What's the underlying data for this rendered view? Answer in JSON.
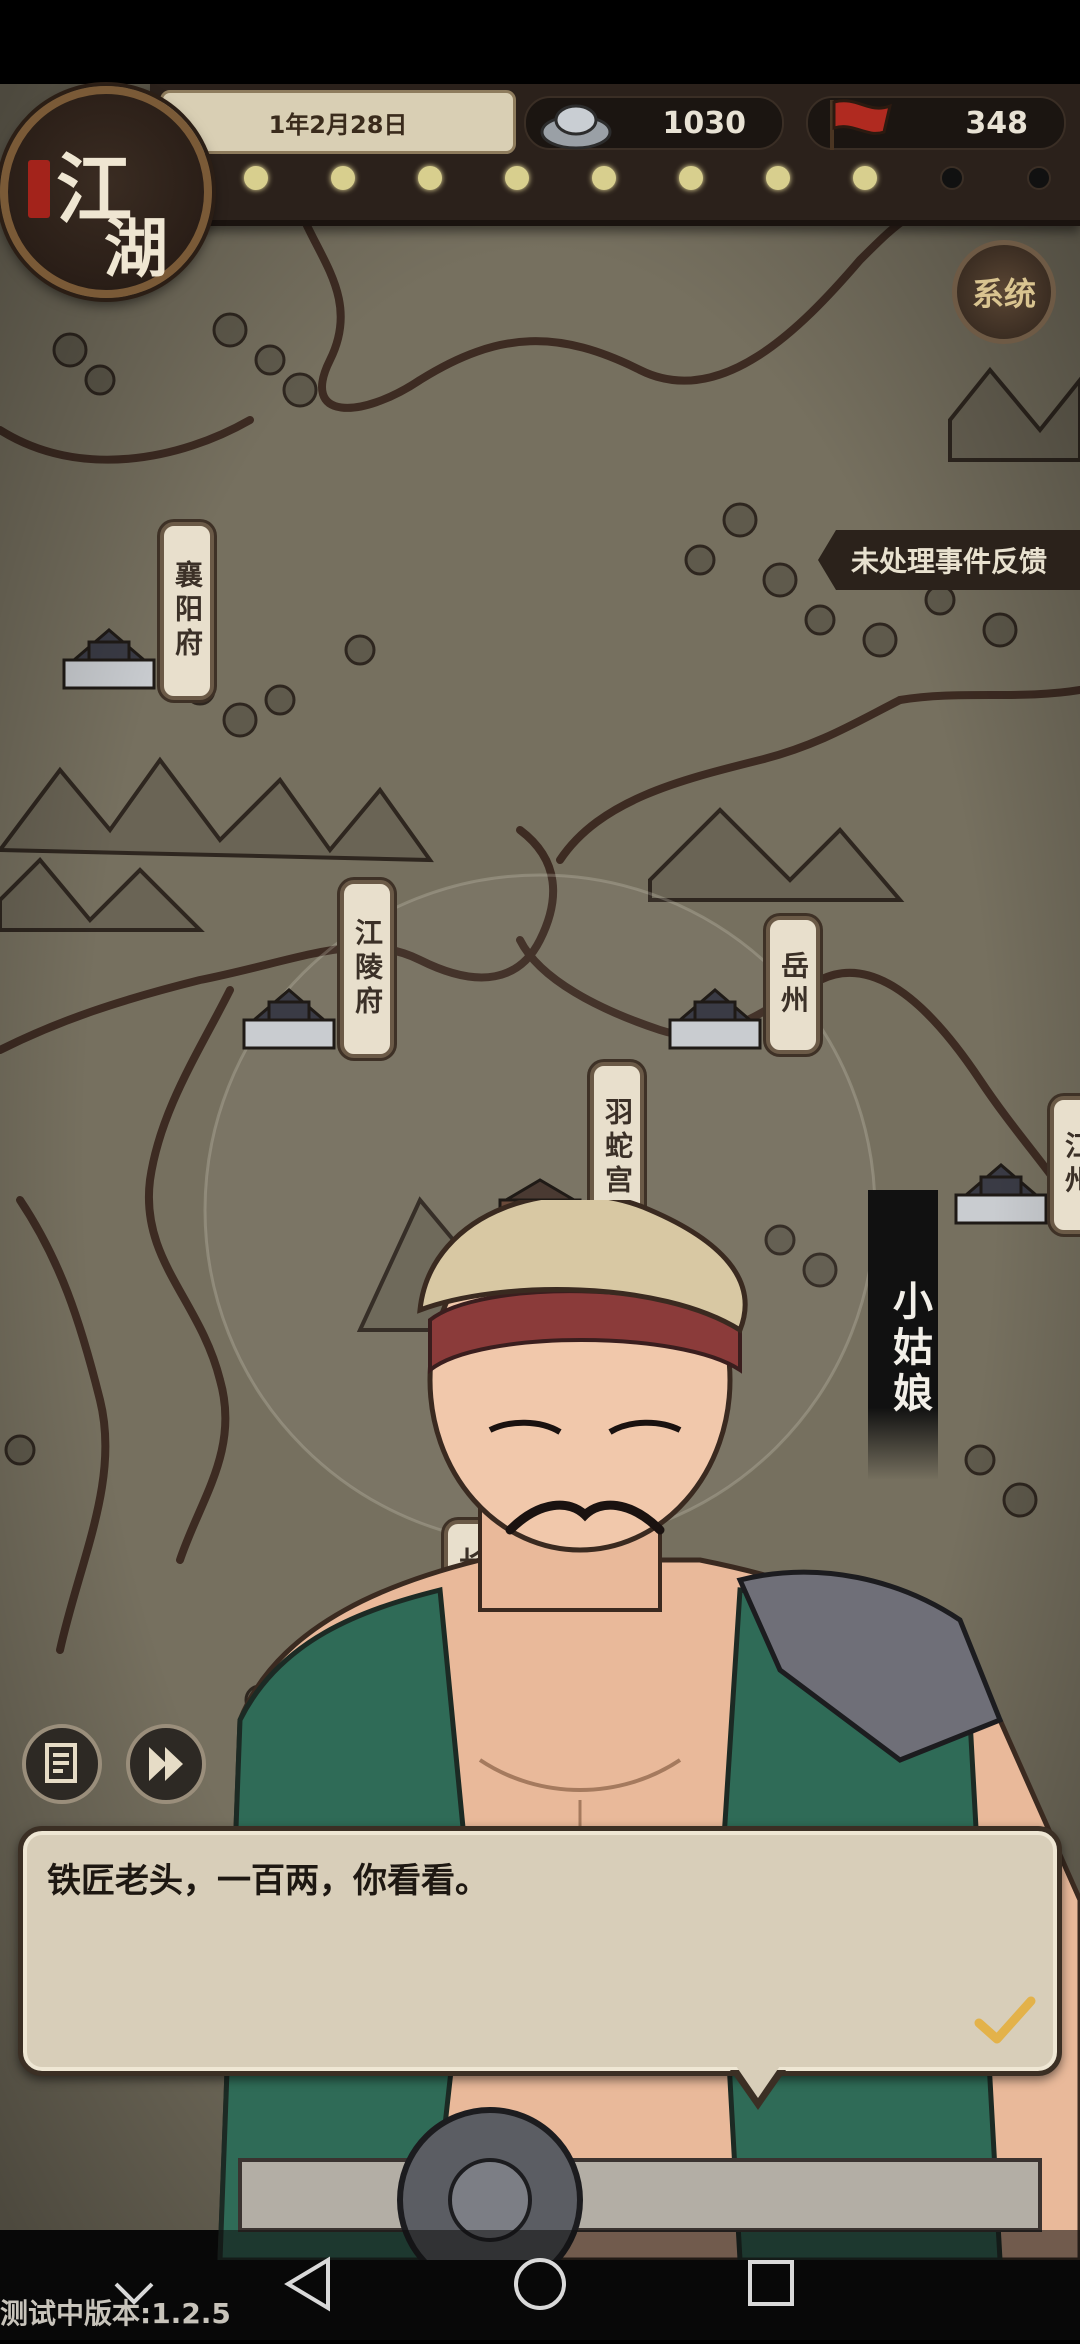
{
  "hud": {
    "logo_char_1": "江",
    "logo_char_2": "湖",
    "date": "1年2月28日",
    "silver": "1030",
    "flags": "348",
    "progress": {
      "filled": 8,
      "total": 10
    }
  },
  "system_button": "系统",
  "feedback_tab": "未处理事件反馈",
  "cities": [
    {
      "label": "襄阳府"
    },
    {
      "label": "江陵府"
    },
    {
      "label": "岳州"
    },
    {
      "label": "羽蛇宫"
    },
    {
      "label": "江州"
    },
    {
      "label": "长"
    }
  ],
  "npc_name": "小姑娘",
  "dialogue": {
    "text": "铁匠老头，一百两，你看看。"
  },
  "controls": {
    "log_icon": "log-icon",
    "skip_icon": "fast-forward-icon",
    "confirm_icon": "checkmark-icon"
  },
  "version": "测试中版本:1.2.5",
  "colors": {
    "map": "#76705f",
    "river": "#3d2b22",
    "panel": "#2b211b",
    "parchment": "#d8ceb9"
  }
}
